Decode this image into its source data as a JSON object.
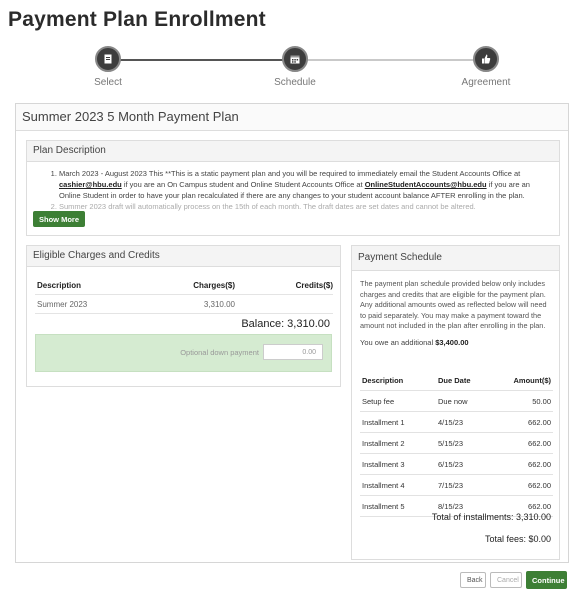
{
  "page_title": "Payment Plan Enrollment",
  "stepper": {
    "steps": [
      {
        "label": "Select",
        "icon": "document-icon"
      },
      {
        "label": "Schedule",
        "icon": "calendar-icon"
      },
      {
        "label": "Agreement",
        "icon": "thumbs-up-icon"
      }
    ],
    "current_step": 2
  },
  "plan": {
    "title": "Summer 2023 5 Month Payment Plan",
    "description": {
      "heading": "Plan Description",
      "item1_a": "March 2023 - August 2023 This **This is a static payment plan and you will be required to immediately email the Student Accounts Office at ",
      "item1_email1": "cashier@hbu.edu",
      "item1_b": " if you are an On Campus student and Online Student Accounts Office at ",
      "item1_email2": "OnlineStudentAccounts@hbu.edu",
      "item1_c": " if you are an Online Student in order to have your plan recalculated if there are any changes to your student account balance AFTER enrolling in the plan.",
      "item2": "Summer 2023 draft will automatically process on the 15th of each month. The draft dates are set dates and cannot be altered.",
      "show_more_label": "Show More"
    },
    "eligible": {
      "heading": "Eligible Charges and Credits",
      "columns": [
        "Description",
        "Charges($)",
        "Credits($)"
      ],
      "rows": [
        {
          "description": "Summer 2023",
          "charges": "3,310.00",
          "credits": ""
        }
      ],
      "balance": "Balance: 3,310.00",
      "down_payment_label": "Optional down payment",
      "down_payment_value": "0.00"
    },
    "schedule": {
      "heading": "Payment Schedule",
      "text": "The payment plan schedule provided below only includes charges and credits that are eligible for the payment plan. Any additional amounts owed as reflected below will need to paid separately. You may make a payment toward the amount not included in the plan after enrolling in the plan.",
      "owe_prefix": "You owe an additional ",
      "owe_amount": "$3,400.00",
      "columns": [
        "Description",
        "Due Date",
        "Amount($)"
      ],
      "rows": [
        {
          "description": "Setup fee",
          "due": "Due now",
          "amount": "50.00"
        },
        {
          "description": "Installment 1",
          "due": "4/15/23",
          "amount": "662.00"
        },
        {
          "description": "Installment 2",
          "due": "5/15/23",
          "amount": "662.00"
        },
        {
          "description": "Installment 3",
          "due": "6/15/23",
          "amount": "662.00"
        },
        {
          "description": "Installment 4",
          "due": "7/15/23",
          "amount": "662.00"
        },
        {
          "description": "Installment 5",
          "due": "8/15/23",
          "amount": "662.00"
        }
      ],
      "total_installments": "Total of installments: 3,310.00",
      "total_fees": "Total fees: $0.00"
    }
  },
  "footer": {
    "back_label": "Back",
    "cancel_label": "Cancel",
    "continue_label": "Continue"
  },
  "colors": {
    "accent_green": "#3d7f35",
    "down_payment_bg": "#d5ebd1",
    "step_active": "#3d3d3d"
  }
}
